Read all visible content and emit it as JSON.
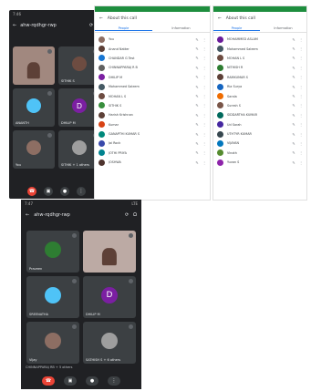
{
  "phone1": {
    "status_left": "7:46",
    "status_right": "LTE",
    "title": "ahw-rqdhgr-rwp",
    "tiles": [
      {
        "name": "",
        "kind": "video",
        "color": "#a1887f"
      },
      {
        "name": "SITHIK S",
        "kind": "photo",
        "color": "#6d4c41"
      },
      {
        "name": "ANANTH",
        "kind": "photo",
        "color": "#4fc3f7"
      },
      {
        "name": "DHILIP M",
        "kind": "letter",
        "letter": "D",
        "color": "#7b1fa2"
      },
      {
        "name": "You",
        "kind": "photo",
        "color": "#8d6e63"
      },
      {
        "name": "SITHIK + 1 others",
        "kind": "photo",
        "color": "#9e9e9e"
      }
    ]
  },
  "panelA": {
    "title": "About this call",
    "tabs": [
      "People",
      "Information"
    ],
    "people": [
      {
        "name": "You",
        "color": "#8d6e63"
      },
      {
        "name": "Anand Natter",
        "color": "#5d4037"
      },
      {
        "name": "CHANDAR G Test",
        "color": "#1976d2"
      },
      {
        "name": "CHINNAPPARAJ R B",
        "color": "#616161"
      },
      {
        "name": "DHILIP M",
        "color": "#7b1fa2"
      },
      {
        "name": "Mohammed Saleem",
        "color": "#455a64"
      },
      {
        "name": "MOHAN L S",
        "color": "#6d4c41"
      },
      {
        "name": "SITHIK S",
        "color": "#388e3c"
      },
      {
        "name": "Harish Krishnan",
        "color": "#5d4037"
      },
      {
        "name": "Kumar",
        "color": "#d84315"
      },
      {
        "name": "GANAPTHI KUMAR S",
        "color": "#00897b"
      },
      {
        "name": "Jai Rock",
        "color": "#3949ab"
      },
      {
        "name": "JOTHI PRIYA",
        "color": "#00838f"
      },
      {
        "name": "JOSHWA",
        "color": "#4e342e"
      }
    ]
  },
  "panelB": {
    "title": "About this call",
    "tabs": [
      "People",
      "Information"
    ],
    "people": [
      {
        "name": "MOHAMMED ASLAM",
        "color": "#6a1b9a"
      },
      {
        "name": "Mohammed Saleem",
        "color": "#455a64"
      },
      {
        "name": "MOHAN L S",
        "color": "#6d4c41"
      },
      {
        "name": "NITHISH R",
        "color": "#2e7d32"
      },
      {
        "name": "RAMKUMAR S",
        "color": "#5d4037"
      },
      {
        "name": "Ria Surya",
        "color": "#1565c0"
      },
      {
        "name": "Sarala",
        "color": "#ef6c00"
      },
      {
        "name": "Suresh S",
        "color": "#795548"
      },
      {
        "name": "SIDDARTHA KUMAR",
        "color": "#00695c"
      },
      {
        "name": "Ud Sarah",
        "color": "#4527a0"
      },
      {
        "name": "UTHTYR KUMAR",
        "color": "#37474f"
      },
      {
        "name": "VIJAYAN",
        "color": "#0277bd"
      },
      {
        "name": "Vinoth",
        "color": "#558b2f"
      },
      {
        "name": "Yuvan S",
        "color": "#8e24aa"
      }
    ]
  },
  "phone2": {
    "status_left": "7:47",
    "status_right": "LTE",
    "title": "ahw-rqdhgr-rwp",
    "tiles": [
      {
        "name": "Praveen",
        "kind": "photo",
        "color": "#2e7d32"
      },
      {
        "name": "",
        "kind": "video",
        "color": "#bcaaa4"
      },
      {
        "name": "SREENATHA",
        "kind": "photo",
        "color": "#4fc3f7"
      },
      {
        "name": "DHILIP M",
        "kind": "letter",
        "letter": "D",
        "color": "#7b1fa2"
      },
      {
        "name": "Vijay",
        "kind": "photo",
        "color": "#8d6e63"
      },
      {
        "name": "SATHISH S + 6 others",
        "kind": "photo",
        "color": "#9e9e9e"
      }
    ],
    "caption": "CHINNAPPARAJ RB + 5 others"
  },
  "icons": {
    "back": "back-arrow-icon",
    "switch_camera": "switch-camera-icon",
    "audio": "headphones-icon",
    "end_call": "end-call-icon",
    "camera": "camera-icon",
    "mic": "mic-icon",
    "more": "more-icon",
    "pin": "pin-icon"
  },
  "colors": {
    "meet_dark": "#202124",
    "tile": "#3c4043",
    "end": "#ea4335",
    "accent": "#1a73e8",
    "green": "#1e8e3e"
  }
}
